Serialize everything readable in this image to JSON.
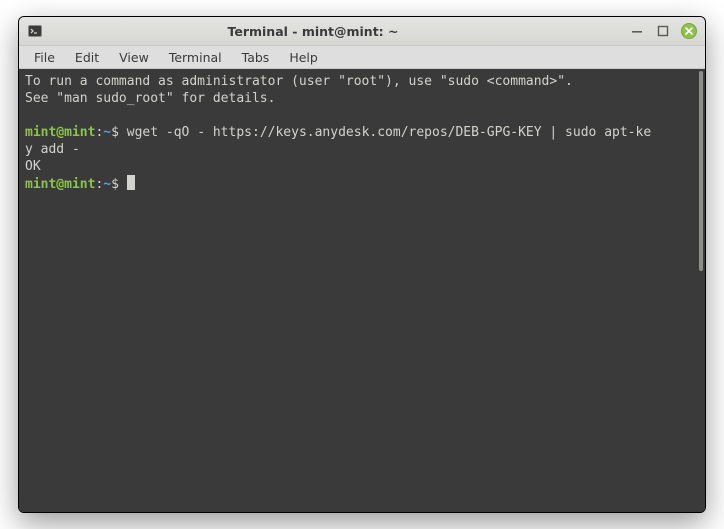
{
  "window": {
    "title": "Terminal - mint@mint: ~"
  },
  "menu": {
    "items": [
      "File",
      "Edit",
      "View",
      "Terminal",
      "Tabs",
      "Help"
    ]
  },
  "terminal": {
    "motd_line1": "To run a command as administrator (user \"root\"), use \"sudo <command>\".",
    "motd_line2": "See \"man sudo_root\" for details.",
    "prompt_user": "mint@mint",
    "prompt_sep1": ":",
    "prompt_path": "~",
    "prompt_dollar": "$",
    "cmd1_a": "wget -qO - https://keys.anydesk.com/repos/DEB-GPG-KEY | sudo apt-ke",
    "cmd1_b": "y add -",
    "out1": "OK"
  }
}
